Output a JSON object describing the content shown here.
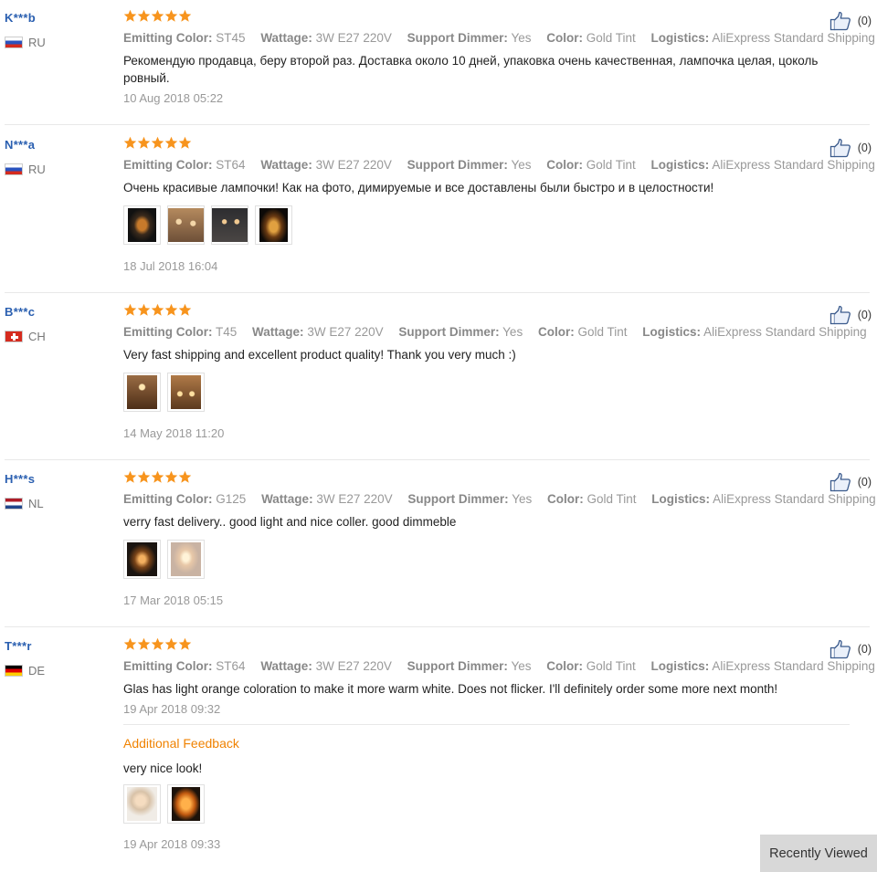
{
  "helpful_count": "(0)",
  "recently_viewed": "Recently Viewed",
  "additional_feedback_label": "Additional Feedback",
  "reviews": [
    {
      "user": "K***b",
      "country": "RU",
      "stars": 5,
      "attrs": [
        {
          "k": "Emitting Color:",
          "v": "ST45"
        },
        {
          "k": "Wattage:",
          "v": "3W E27 220V"
        },
        {
          "k": "Support Dimmer:",
          "v": "Yes"
        },
        {
          "k": "Color:",
          "v": "Gold Tint"
        },
        {
          "k": "Logistics:",
          "v": "AliExpress Standard Shipping"
        }
      ],
      "text": "Рекомендую продавца, беру второй раз. Доставка около 10 дней, упаковка очень качественная, лампочка целая, цоколь ровный.",
      "date": "10 Aug 2018 05:22"
    },
    {
      "user": "N***a",
      "country": "RU",
      "stars": 5,
      "attrs": [
        {
          "k": "Emitting Color:",
          "v": "ST64"
        },
        {
          "k": "Wattage:",
          "v": "3W E27 220V"
        },
        {
          "k": "Support Dimmer:",
          "v": "Yes"
        },
        {
          "k": "Color:",
          "v": "Gold Tint"
        },
        {
          "k": "Logistics:",
          "v": "AliExpress Standard Shipping"
        }
      ],
      "text": "Очень красивые лампочки! Как на фото, димируемые и все доставлены были быстро и в целостности!",
      "date": "18 Jul 2018 16:04"
    },
    {
      "user": "B***c",
      "country": "CH",
      "stars": 5,
      "attrs": [
        {
          "k": "Emitting Color:",
          "v": "T45"
        },
        {
          "k": "Wattage:",
          "v": "3W E27 220V"
        },
        {
          "k": "Support Dimmer:",
          "v": "Yes"
        },
        {
          "k": "Color:",
          "v": "Gold Tint"
        },
        {
          "k": "Logistics:",
          "v": "AliExpress Standard Shipping"
        }
      ],
      "text": "Very fast shipping and excellent product quality! Thank you very much :)",
      "date": "14 May 2018 11:20"
    },
    {
      "user": "H***s",
      "country": "NL",
      "stars": 5,
      "attrs": [
        {
          "k": "Emitting Color:",
          "v": "G125"
        },
        {
          "k": "Wattage:",
          "v": "3W E27 220V"
        },
        {
          "k": "Support Dimmer:",
          "v": "Yes"
        },
        {
          "k": "Color:",
          "v": "Gold Tint"
        },
        {
          "k": "Logistics:",
          "v": "AliExpress Standard Shipping"
        }
      ],
      "text": "verry fast delivery.. good light and nice coller. good dimmeble",
      "date": "17 Mar 2018 05:15"
    },
    {
      "user": "T***r",
      "country": "DE",
      "stars": 5,
      "attrs": [
        {
          "k": "Emitting Color:",
          "v": "ST64"
        },
        {
          "k": "Wattage:",
          "v": "3W E27 220V"
        },
        {
          "k": "Support Dimmer:",
          "v": "Yes"
        },
        {
          "k": "Color:",
          "v": "Gold Tint"
        },
        {
          "k": "Logistics:",
          "v": "AliExpress Standard Shipping"
        }
      ],
      "text": "Glas has light orange coloration to make it more warm white. Does not flicker. I'll definitely order some more next month!",
      "date": "19 Apr 2018 09:32",
      "additional_text": "very nice look!",
      "additional_date": "19 Apr 2018 09:33"
    }
  ]
}
